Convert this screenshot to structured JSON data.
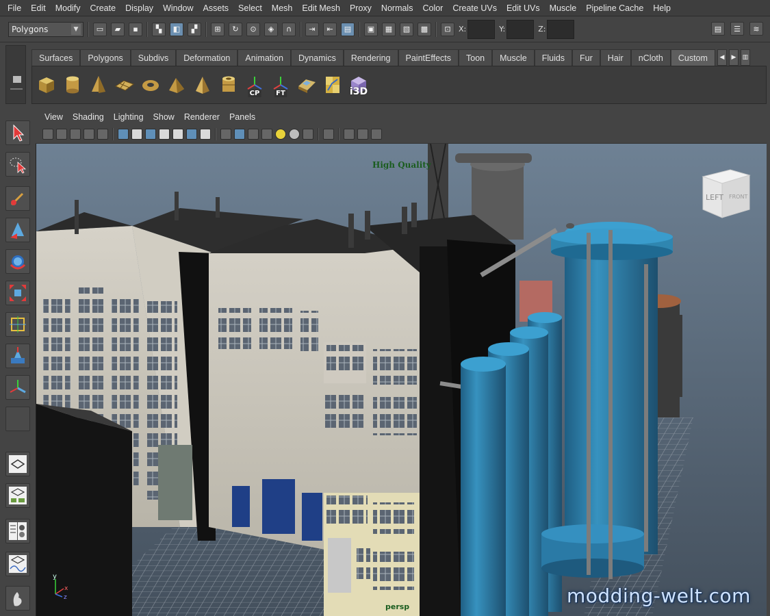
{
  "menubar": {
    "items": [
      "File",
      "Edit",
      "Modify",
      "Create",
      "Display",
      "Window",
      "Assets",
      "Select",
      "Mesh",
      "Edit Mesh",
      "Proxy",
      "Normals",
      "Color",
      "Create UVs",
      "Edit UVs",
      "Muscle",
      "Pipeline Cache",
      "Help"
    ]
  },
  "statusline": {
    "mode_value": "Polygons",
    "x_label": "X:",
    "y_label": "Y:",
    "z_label": "Z:"
  },
  "shelf": {
    "tabs": [
      "Surfaces",
      "Polygons",
      "Subdivs",
      "Deformation",
      "Animation",
      "Dynamics",
      "Rendering",
      "PaintEffects",
      "Toon",
      "Muscle",
      "Fluids",
      "Fur",
      "Hair",
      "nCloth",
      "Custom"
    ],
    "active_tab": "Custom",
    "icon_labels": {
      "cp": "CP",
      "ft": "FT",
      "i3d": "i3D"
    }
  },
  "panel": {
    "menu": [
      "View",
      "Shading",
      "Lighting",
      "Show",
      "Renderer",
      "Panels"
    ]
  },
  "viewport": {
    "quality_label": "High Quality",
    "view_cube_left": "LEFT",
    "view_cube_front": "FRONT",
    "camera_label": "persp",
    "axis_y": "y",
    "axis_x": "x",
    "axis_z": "z",
    "watermark": "modding-welt.com"
  },
  "colors": {
    "menu_bg": "#3e3e3e",
    "panel_bg": "#444444",
    "silo_blue": "#2f86b0",
    "hq_label": "#1a5c1e"
  }
}
